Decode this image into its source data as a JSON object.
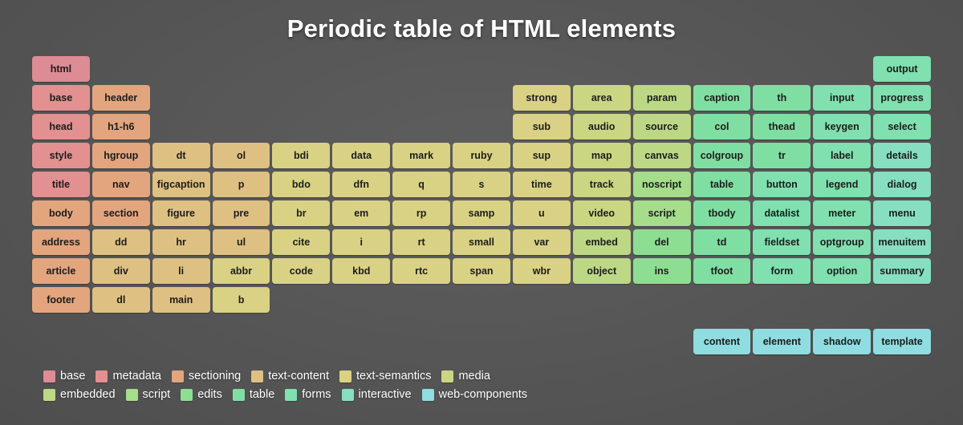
{
  "title": "Periodic table of HTML elements",
  "grid": {
    "columns": 15,
    "rows": 9
  },
  "categories": [
    {
      "key": "base",
      "label": "base",
      "color": "#dd8b95"
    },
    {
      "key": "metadata",
      "label": "metadata",
      "color": "#e29090"
    },
    {
      "key": "sectioning",
      "label": "sectioning",
      "color": "#e3a57e"
    },
    {
      "key": "text-content",
      "label": "text-content",
      "color": "#dec083"
    },
    {
      "key": "text-semantics",
      "label": "text-semantics",
      "color": "#d9d284"
    },
    {
      "key": "media",
      "label": "media",
      "color": "#cbd683"
    },
    {
      "key": "embedded",
      "label": "embedded",
      "color": "#bcd885"
    },
    {
      "key": "script",
      "label": "script",
      "color": "#a5dd8b"
    },
    {
      "key": "edits",
      "label": "edits",
      "color": "#8dde92"
    },
    {
      "key": "table",
      "label": "table",
      "color": "#7fdfa2"
    },
    {
      "key": "forms",
      "label": "forms",
      "color": "#80e0b0"
    },
    {
      "key": "interactive",
      "label": "interactive",
      "color": "#86dfc0"
    },
    {
      "key": "web-components",
      "label": "web-components",
      "color": "#8fdde0"
    }
  ],
  "cells": [
    {
      "label": "html",
      "col": 1,
      "row": 1,
      "category": "base"
    },
    {
      "label": "output",
      "col": 15,
      "row": 1,
      "category": "forms"
    },
    {
      "label": "base",
      "col": 1,
      "row": 2,
      "category": "metadata"
    },
    {
      "label": "header",
      "col": 2,
      "row": 2,
      "category": "sectioning"
    },
    {
      "label": "strong",
      "col": 9,
      "row": 2,
      "category": "text-semantics"
    },
    {
      "label": "area",
      "col": 10,
      "row": 2,
      "category": "media"
    },
    {
      "label": "param",
      "col": 11,
      "row": 2,
      "category": "embedded"
    },
    {
      "label": "caption",
      "col": 12,
      "row": 2,
      "category": "table"
    },
    {
      "label": "th",
      "col": 13,
      "row": 2,
      "category": "table"
    },
    {
      "label": "input",
      "col": 14,
      "row": 2,
      "category": "forms"
    },
    {
      "label": "progress",
      "col": 15,
      "row": 2,
      "category": "forms"
    },
    {
      "label": "head",
      "col": 1,
      "row": 3,
      "category": "metadata"
    },
    {
      "label": "h1-h6",
      "col": 2,
      "row": 3,
      "category": "sectioning"
    },
    {
      "label": "sub",
      "col": 9,
      "row": 3,
      "category": "text-semantics"
    },
    {
      "label": "audio",
      "col": 10,
      "row": 3,
      "category": "media"
    },
    {
      "label": "source",
      "col": 11,
      "row": 3,
      "category": "embedded"
    },
    {
      "label": "col",
      "col": 12,
      "row": 3,
      "category": "table"
    },
    {
      "label": "thead",
      "col": 13,
      "row": 3,
      "category": "table"
    },
    {
      "label": "keygen",
      "col": 14,
      "row": 3,
      "category": "forms"
    },
    {
      "label": "select",
      "col": 15,
      "row": 3,
      "category": "forms"
    },
    {
      "label": "style",
      "col": 1,
      "row": 4,
      "category": "metadata"
    },
    {
      "label": "hgroup",
      "col": 2,
      "row": 4,
      "category": "sectioning"
    },
    {
      "label": "dt",
      "col": 3,
      "row": 4,
      "category": "text-content"
    },
    {
      "label": "ol",
      "col": 4,
      "row": 4,
      "category": "text-content"
    },
    {
      "label": "bdi",
      "col": 5,
      "row": 4,
      "category": "text-semantics"
    },
    {
      "label": "data",
      "col": 6,
      "row": 4,
      "category": "text-semantics"
    },
    {
      "label": "mark",
      "col": 7,
      "row": 4,
      "category": "text-semantics"
    },
    {
      "label": "ruby",
      "col": 8,
      "row": 4,
      "category": "text-semantics"
    },
    {
      "label": "sup",
      "col": 9,
      "row": 4,
      "category": "text-semantics"
    },
    {
      "label": "map",
      "col": 10,
      "row": 4,
      "category": "media"
    },
    {
      "label": "canvas",
      "col": 11,
      "row": 4,
      "category": "embedded"
    },
    {
      "label": "colgroup",
      "col": 12,
      "row": 4,
      "category": "table"
    },
    {
      "label": "tr",
      "col": 13,
      "row": 4,
      "category": "table"
    },
    {
      "label": "label",
      "col": 14,
      "row": 4,
      "category": "forms"
    },
    {
      "label": "details",
      "col": 15,
      "row": 4,
      "category": "interactive"
    },
    {
      "label": "title",
      "col": 1,
      "row": 5,
      "category": "metadata"
    },
    {
      "label": "nav",
      "col": 2,
      "row": 5,
      "category": "sectioning"
    },
    {
      "label": "figcaption",
      "col": 3,
      "row": 5,
      "category": "text-content"
    },
    {
      "label": "p",
      "col": 4,
      "row": 5,
      "category": "text-content"
    },
    {
      "label": "bdo",
      "col": 5,
      "row": 5,
      "category": "text-semantics"
    },
    {
      "label": "dfn",
      "col": 6,
      "row": 5,
      "category": "text-semantics"
    },
    {
      "label": "q",
      "col": 7,
      "row": 5,
      "category": "text-semantics"
    },
    {
      "label": "s",
      "col": 8,
      "row": 5,
      "category": "text-semantics"
    },
    {
      "label": "time",
      "col": 9,
      "row": 5,
      "category": "text-semantics"
    },
    {
      "label": "track",
      "col": 10,
      "row": 5,
      "category": "media"
    },
    {
      "label": "noscript",
      "col": 11,
      "row": 5,
      "category": "script"
    },
    {
      "label": "table",
      "col": 12,
      "row": 5,
      "category": "table"
    },
    {
      "label": "button",
      "col": 13,
      "row": 5,
      "category": "forms"
    },
    {
      "label": "legend",
      "col": 14,
      "row": 5,
      "category": "forms"
    },
    {
      "label": "dialog",
      "col": 15,
      "row": 5,
      "category": "interactive"
    },
    {
      "label": "body",
      "col": 1,
      "row": 6,
      "category": "sectioning"
    },
    {
      "label": "section",
      "col": 2,
      "row": 6,
      "category": "sectioning"
    },
    {
      "label": "figure",
      "col": 3,
      "row": 6,
      "category": "text-content"
    },
    {
      "label": "pre",
      "col": 4,
      "row": 6,
      "category": "text-content"
    },
    {
      "label": "br",
      "col": 5,
      "row": 6,
      "category": "text-semantics"
    },
    {
      "label": "em",
      "col": 6,
      "row": 6,
      "category": "text-semantics"
    },
    {
      "label": "rp",
      "col": 7,
      "row": 6,
      "category": "text-semantics"
    },
    {
      "label": "samp",
      "col": 8,
      "row": 6,
      "category": "text-semantics"
    },
    {
      "label": "u",
      "col": 9,
      "row": 6,
      "category": "text-semantics"
    },
    {
      "label": "video",
      "col": 10,
      "row": 6,
      "category": "media"
    },
    {
      "label": "script",
      "col": 11,
      "row": 6,
      "category": "script"
    },
    {
      "label": "tbody",
      "col": 12,
      "row": 6,
      "category": "table"
    },
    {
      "label": "datalist",
      "col": 13,
      "row": 6,
      "category": "forms"
    },
    {
      "label": "meter",
      "col": 14,
      "row": 6,
      "category": "forms"
    },
    {
      "label": "menu",
      "col": 15,
      "row": 6,
      "category": "interactive"
    },
    {
      "label": "address",
      "col": 1,
      "row": 7,
      "category": "sectioning"
    },
    {
      "label": "dd",
      "col": 2,
      "row": 7,
      "category": "text-content"
    },
    {
      "label": "hr",
      "col": 3,
      "row": 7,
      "category": "text-content"
    },
    {
      "label": "ul",
      "col": 4,
      "row": 7,
      "category": "text-content"
    },
    {
      "label": "cite",
      "col": 5,
      "row": 7,
      "category": "text-semantics"
    },
    {
      "label": "i",
      "col": 6,
      "row": 7,
      "category": "text-semantics"
    },
    {
      "label": "rt",
      "col": 7,
      "row": 7,
      "category": "text-semantics"
    },
    {
      "label": "small",
      "col": 8,
      "row": 7,
      "category": "text-semantics"
    },
    {
      "label": "var",
      "col": 9,
      "row": 7,
      "category": "text-semantics"
    },
    {
      "label": "embed",
      "col": 10,
      "row": 7,
      "category": "embedded"
    },
    {
      "label": "del",
      "col": 11,
      "row": 7,
      "category": "edits"
    },
    {
      "label": "td",
      "col": 12,
      "row": 7,
      "category": "table"
    },
    {
      "label": "fieldset",
      "col": 13,
      "row": 7,
      "category": "forms"
    },
    {
      "label": "optgroup",
      "col": 14,
      "row": 7,
      "category": "forms"
    },
    {
      "label": "menuitem",
      "col": 15,
      "row": 7,
      "category": "interactive"
    },
    {
      "label": "article",
      "col": 1,
      "row": 8,
      "category": "sectioning"
    },
    {
      "label": "div",
      "col": 2,
      "row": 8,
      "category": "text-content"
    },
    {
      "label": "li",
      "col": 3,
      "row": 8,
      "category": "text-content"
    },
    {
      "label": "abbr",
      "col": 4,
      "row": 8,
      "category": "text-semantics"
    },
    {
      "label": "code",
      "col": 5,
      "row": 8,
      "category": "text-semantics"
    },
    {
      "label": "kbd",
      "col": 6,
      "row": 8,
      "category": "text-semantics"
    },
    {
      "label": "rtc",
      "col": 7,
      "row": 8,
      "category": "text-semantics"
    },
    {
      "label": "span",
      "col": 8,
      "row": 8,
      "category": "text-semantics"
    },
    {
      "label": "wbr",
      "col": 9,
      "row": 8,
      "category": "text-semantics"
    },
    {
      "label": "object",
      "col": 10,
      "row": 8,
      "category": "embedded"
    },
    {
      "label": "ins",
      "col": 11,
      "row": 8,
      "category": "edits"
    },
    {
      "label": "tfoot",
      "col": 12,
      "row": 8,
      "category": "table"
    },
    {
      "label": "form",
      "col": 13,
      "row": 8,
      "category": "forms"
    },
    {
      "label": "option",
      "col": 14,
      "row": 8,
      "category": "forms"
    },
    {
      "label": "summary",
      "col": 15,
      "row": 8,
      "category": "interactive"
    },
    {
      "label": "footer",
      "col": 1,
      "row": 9,
      "category": "sectioning"
    },
    {
      "label": "dl",
      "col": 2,
      "row": 9,
      "category": "text-content"
    },
    {
      "label": "main",
      "col": 3,
      "row": 9,
      "category": "text-content"
    },
    {
      "label": "b",
      "col": 4,
      "row": 9,
      "category": "text-semantics"
    }
  ],
  "web_components_row": [
    {
      "label": "content",
      "col": 12,
      "category": "web-components"
    },
    {
      "label": "element",
      "col": 13,
      "category": "web-components"
    },
    {
      "label": "shadow",
      "col": 14,
      "category": "web-components"
    },
    {
      "label": "template",
      "col": 15,
      "category": "web-components"
    }
  ],
  "legend_rows": [
    [
      "base",
      "metadata",
      "sectioning",
      "text-content",
      "text-semantics",
      "media"
    ],
    [
      "embedded",
      "script",
      "edits",
      "table",
      "forms",
      "interactive",
      "web-components"
    ]
  ]
}
